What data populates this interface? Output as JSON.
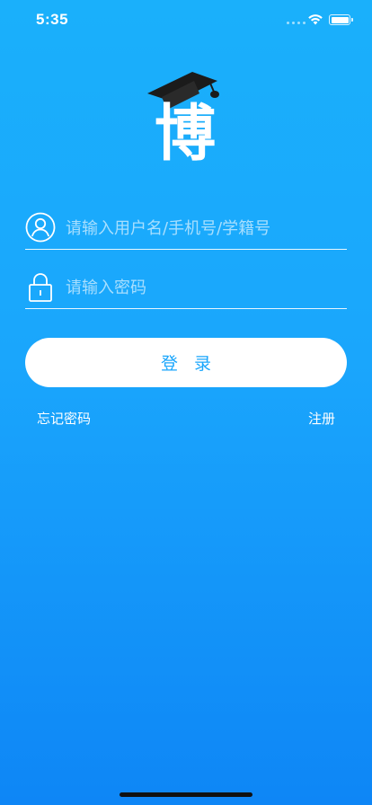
{
  "status_bar": {
    "time": "5:35"
  },
  "logo": {
    "character": "博",
    "icon": "graduation-cap-icon"
  },
  "login_form": {
    "username": {
      "placeholder": "请输入用户名/手机号/学籍号",
      "value": "",
      "icon": "user-icon"
    },
    "password": {
      "placeholder": "请输入密码",
      "value": "",
      "icon": "lock-icon"
    },
    "submit_label": "登录"
  },
  "links": {
    "forgot_password": "忘记密码",
    "register": "注册"
  },
  "colors": {
    "gradient_top": "#1ab0fb",
    "gradient_bottom": "#0e86f6",
    "button_bg": "#ffffff",
    "button_text": "#1aa6fc"
  }
}
